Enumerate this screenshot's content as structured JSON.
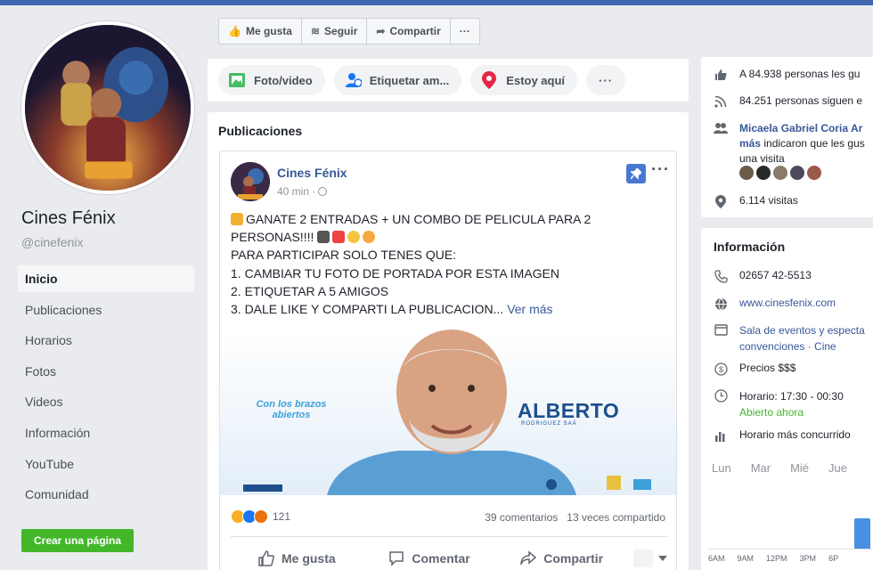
{
  "page": {
    "name": "Cines Fénix",
    "handle": "@cinefenix"
  },
  "nav": {
    "items": [
      {
        "label": "Inicio",
        "active": true
      },
      {
        "label": "Publicaciones"
      },
      {
        "label": "Horarios"
      },
      {
        "label": "Fotos"
      },
      {
        "label": "Videos"
      },
      {
        "label": "Información"
      },
      {
        "label": "YouTube"
      },
      {
        "label": "Comunidad"
      }
    ],
    "create_page": "Crear una página"
  },
  "actionbar": {
    "like": "Me gusta",
    "follow": "Seguir",
    "share": "Compartir",
    "more": "···"
  },
  "composer": {
    "photo_video": "Foto/video",
    "tag_friends": "Etiquetar am...",
    "here": "Estoy aquí",
    "more": "···"
  },
  "feed": {
    "title": "Publicaciones"
  },
  "post": {
    "author": "Cines Fénix",
    "time": "40 min ·",
    "lines": [
      "GANATE 2 ENTRADAS + UN COMBO DE PELICULA PARA 2",
      "PERSONAS!!!!",
      "PARA PARTICIPAR SOLO TENES QUE:",
      "1. CAMBIAR TU FOTO DE PORTADA POR ESTA IMAGEN",
      "2. ETIQUETAR A 5 AMIGOS",
      "3. DALE LIKE Y COMPARTI LA PUBLICACION..."
    ],
    "see_more": "Ver más",
    "image": {
      "slogan": "Con los brazos abiertos",
      "brand": "ALBERTO",
      "brand_sub": "RODRIGUEZ SAÁ"
    },
    "reactions_count": "121",
    "comments": "39 comentarios",
    "shares": "13 veces compartido",
    "actions": {
      "like": "Me gusta",
      "comment": "Comentar",
      "share": "Compartir"
    }
  },
  "community": {
    "likes": "A 84.938 personas les gu",
    "follows": "84.251 personas siguen e",
    "friends_name": "Micaela Gabriel Coria Ar",
    "friends_rest1": "más",
    "friends_rest2": " indicaron que les gus",
    "friends_rest3": "una visita",
    "visits": "6.114 visitas"
  },
  "info": {
    "title": "Información",
    "phone": "02657 42-5513",
    "website": "www.cinesfenix.com",
    "category1": "Sala de eventos y especta",
    "category2": "convenciones · Cine",
    "price": "Precios $$$",
    "hours": "Horario: 17:30 - 00:30",
    "open_now": "Abierto ahora",
    "busy": "Horario más concurrido",
    "days": [
      "Lun",
      "Mar",
      "Mié",
      "Jue"
    ],
    "hour_ticks": [
      "6AM",
      "9AM",
      "12PM",
      "3PM",
      "6P"
    ]
  },
  "colors": {
    "fb_blue": "#4267b2",
    "link": "#385898",
    "green": "#42b72a"
  }
}
